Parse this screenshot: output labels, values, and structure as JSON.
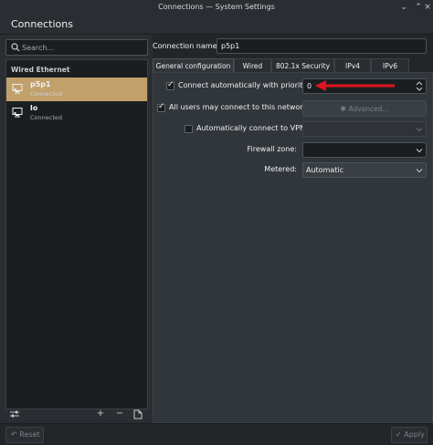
{
  "window": {
    "title": "Connections — System Settings"
  },
  "header": {
    "title": "Connections"
  },
  "sidebar": {
    "search_placeholder": "Search...",
    "group_label": "Wired Ethernet",
    "connections": [
      {
        "name": "p5p1",
        "status": "Connected",
        "selected": true
      },
      {
        "name": "lo",
        "status": "Connected",
        "selected": false
      }
    ]
  },
  "editor": {
    "connection_name_label": "Connection name:",
    "connection_name_value": "p5p1",
    "tabs": [
      {
        "label": "General configuration",
        "active": true
      },
      {
        "label": "Wired",
        "active": false
      },
      {
        "label": "802.1x Security",
        "active": false
      },
      {
        "label": "IPv4",
        "active": false
      },
      {
        "label": "IPv6",
        "active": false
      }
    ],
    "general": {
      "auto_connect_label": "Connect automatically with priority",
      "auto_connect_checked": true,
      "priority_value": "0",
      "all_users_label": "All users may connect to this network",
      "all_users_checked": true,
      "advanced_button": "Advanced...",
      "auto_vpn_label": "Automatically connect to VPN",
      "auto_vpn_checked": false,
      "vpn_value": "",
      "firewall_label": "Firewall zone:",
      "firewall_value": "",
      "metered_label": "Metered:",
      "metered_value": "Automatic"
    }
  },
  "footer": {
    "reset_label": "Reset",
    "apply_label": "Apply"
  },
  "colors": {
    "selection": "#c1a06b",
    "background": "#232629",
    "annotation": "#e0141e"
  }
}
